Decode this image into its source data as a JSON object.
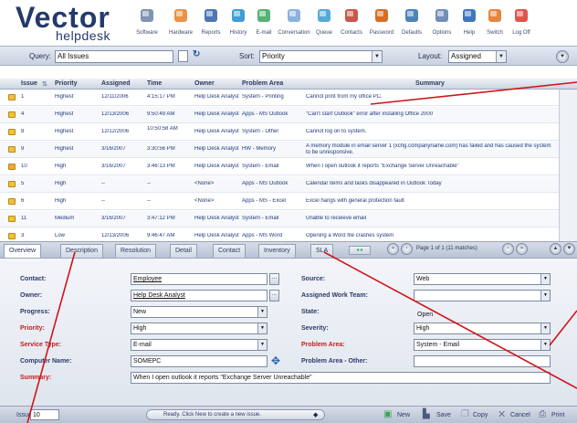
{
  "header": {
    "logo_main": "Vector",
    "logo_sub": "helpdesk",
    "toolbar": [
      {
        "label": "Software",
        "icon": "software-icon",
        "color": "#6b7fa8"
      },
      {
        "label": "Hardware",
        "icon": "hardware-icon",
        "color": "#e67e22"
      },
      {
        "label": "Reports",
        "icon": "reports-icon",
        "color": "#2e5da8"
      },
      {
        "label": "History",
        "icon": "history-icon",
        "color": "#1f8ccf"
      },
      {
        "label": "E-mail",
        "icon": "email-icon",
        "color": "#3aa55a"
      },
      {
        "label": "Conversation",
        "icon": "conversation-icon",
        "color": "#78a6d6"
      },
      {
        "label": "Queue",
        "icon": "queue-icon",
        "color": "#3a9bd1"
      },
      {
        "label": "Contacts",
        "icon": "contacts-icon",
        "color": "#c0392b"
      },
      {
        "label": "Password",
        "icon": "password-icon",
        "color": "#d35400"
      },
      {
        "label": "Defaults",
        "icon": "defaults-icon",
        "color": "#2b6fb0"
      },
      {
        "label": "Options",
        "icon": "options-icon",
        "color": "#5b7aa7"
      },
      {
        "label": "Help",
        "icon": "help-icon",
        "color": "#1d5fb3"
      },
      {
        "label": "Switch",
        "icon": "switch-icon",
        "color": "#e2701b"
      },
      {
        "label": "Log Off",
        "icon": "logoff-icon",
        "color": "#d9372a"
      }
    ]
  },
  "querybar": {
    "query_label": "Query:",
    "query_value": "All Issues",
    "sort_label": "Sort:",
    "sort_value": "Priority",
    "layout_label": "Layout:",
    "layout_value": "Assigned"
  },
  "grid": {
    "columns": [
      "Issue",
      "Priority",
      "Assigned",
      "Time",
      "Owner",
      "Problem Area",
      "Summary"
    ],
    "rows": [
      {
        "issue": "1",
        "priority": "Highest",
        "assigned": "12/11/2006",
        "time": "4:15:17 PM",
        "owner": "Help Desk Analyst",
        "area": "System - Printing",
        "summary": "Cannot print from my office PC."
      },
      {
        "issue": "4",
        "priority": "Highest",
        "assigned": "12/13/2006",
        "time": "9:50:49 AM",
        "owner": "Help Desk Analyst",
        "area": "Apps - MS Outlook",
        "summary": "\"Can't start Outlook\" error after installing Office 2000"
      },
      {
        "issue": "8",
        "priority": "Highest",
        "assigned": "12/12/2006",
        "time": "10:50:58 AM",
        "owner": "Help Desk Analyst",
        "area": "System - Other",
        "summary": "Cannot log on to system."
      },
      {
        "issue": "9",
        "priority": "Highest",
        "assigned": "3/16/2007",
        "time": "3:30:56 PM",
        "owner": "Help Desk Analyst",
        "area": "HW - Memory",
        "summary": "A memory module in email server 1 (xchg.companyname.com) has failed and has caused the system to be unresponsive."
      },
      {
        "issue": "10",
        "priority": "High",
        "assigned": "3/16/2007",
        "time": "3:46:13 PM",
        "owner": "Help Desk Analyst",
        "area": "System - Email",
        "summary": "When I open outlook it reports \"Exchange Server Unreachable\""
      },
      {
        "issue": "5",
        "priority": "High",
        "assigned": "--",
        "time": "--",
        "owner": "<None>",
        "area": "Apps - MS Outlook",
        "summary": "Calendar items and tasks disappeared in Outlook Today"
      },
      {
        "issue": "6",
        "priority": "High",
        "assigned": "--",
        "time": "--",
        "owner": "<None>",
        "area": "Apps - MS - Excel",
        "summary": "Excel hangs with general protection fault"
      },
      {
        "issue": "11",
        "priority": "Medium",
        "assigned": "3/16/2007",
        "time": "3:47:12 PM",
        "owner": "Help Desk Analyst",
        "area": "System - Email",
        "summary": "Unable to receieve email"
      },
      {
        "issue": "3",
        "priority": "Low",
        "assigned": "12/13/2006",
        "time": "9:46:47 AM",
        "owner": "Help Desk Analyst",
        "area": "Apps - MS Word",
        "summary": "Opening a Word file crashes system"
      }
    ]
  },
  "tabs": [
    "Overview",
    "Description",
    "Resolution",
    "Detail",
    "Contact",
    "Inventory",
    "SLA"
  ],
  "pager": {
    "text": "Page 1 of 1 (11 matches)"
  },
  "form": {
    "contact_label": "Contact:",
    "contact_value": "Employee",
    "owner_label": "Owner:",
    "owner_value": "Help Desk Analyst",
    "progress_label": "Progress:",
    "progress_value": "New",
    "priority_label": "Priority:",
    "priority_value": "High",
    "service_label": "Service Type:",
    "service_value": "E-mail",
    "computer_label": "Computer Name:",
    "computer_value": "SOMEPC",
    "summary_label": "Summary:",
    "summary_value": "When I open outlook it reports \"Exchange Server Unreachable\"",
    "source_label": "Source:",
    "source_value": "Web",
    "team_label": "Assigned Work Team:",
    "team_value": "",
    "state_label": "State:",
    "state_value": "Open",
    "severity_label": "Severity:",
    "severity_value": "High",
    "area_label": "Problem Area:",
    "area_value": "System - Email",
    "area_other_label": "Problem Area - Other:",
    "area_other_value": ""
  },
  "status": {
    "issue_label": "Issue:",
    "issue_value": "10",
    "message": "Ready. Click New to create a new issue.",
    "new_label": "New",
    "save_label": "Save",
    "copy_label": "Copy",
    "cancel_label": "Cancel",
    "print_label": "Print"
  }
}
